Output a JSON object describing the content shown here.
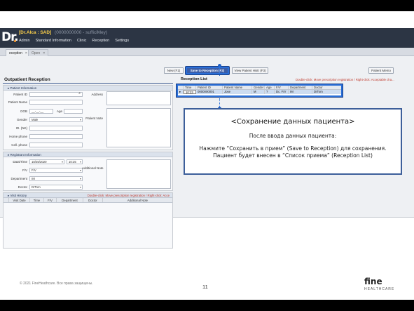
{
  "app": {
    "logo": "Dr.",
    "system_name": "[Dr.Alca : SAD]",
    "system_sub": "(0000000000 - sufficiMey)",
    "menu": [
      "Admin",
      "Standard Information",
      "Clinic",
      "Reception",
      "Settings"
    ],
    "tabs": [
      {
        "label": "eception",
        "close": "×"
      },
      {
        "label": "Open",
        "close": "×"
      }
    ]
  },
  "toolbar": {
    "new_label": "New (F1)",
    "save_label": "Save to Reception (F2)",
    "view_history_label": "View Patient Histr (F3)",
    "patient_memo_label": "Patient Memo"
  },
  "left": {
    "section_title": "Outpatient Reception",
    "patient_info": {
      "title": "Patient Information",
      "patient_id_label": "Patient ID",
      "patient_name_label": "Patient Name",
      "dob_label": "DOB",
      "dob_value": "__-__-__",
      "age_label": "Age",
      "gender_label": "Gender",
      "gender_value": "Male",
      "id_no_label": "ID. (NK)",
      "home_phone_label": "Home phone",
      "cell_phone_label": "Cell. phone",
      "address_label": "Address",
      "patient_note_label": "Patient Note"
    },
    "registrant_info": {
      "title": "Registrant Information",
      "datetime_label": "Data/Time",
      "date_value": "10/25/2020",
      "time_value": "10:25",
      "fv_label": "F/V",
      "fv_value": "F/V",
      "department_label": "Department",
      "department_value": "IM",
      "doctor_label": "Doctor",
      "doctor_value": "DrTom",
      "additional_note_label": "Additional Note"
    },
    "visit_history": {
      "title": "Visit History",
      "hint": "Double-click: Move prescription registration / Right-click: Acce",
      "columns": [
        "",
        "Visit Date",
        "Time",
        "F/V",
        "Department",
        "Doctor",
        "Additional Note"
      ]
    }
  },
  "right": {
    "title": "Reception List",
    "hint": "Double-click: Move prescription registration / Right-click: Acceptable cha...",
    "columns": [
      "",
      "Time",
      "Patient ID",
      "Patient Name",
      "Gender",
      "Age",
      "F/V",
      "Department",
      "Doctor"
    ],
    "rows": [
      [
        "▸",
        "10:23",
        "0000000001",
        "Jose",
        "M",
        "?",
        "Dc. F/V",
        "IM",
        "DrTom"
      ]
    ]
  },
  "callout": {
    "title": "<Сохранение данных пациента>",
    "subtitle": "После ввода данных пациента:",
    "line1": "Нажмите “Сохранить в прием” (Save to Reception) для сохранения.",
    "line2": "Пациент будет внесен в “Список приема” (Reception List)"
  },
  "footer": {
    "copyright": "© 2021 FineHeathcare. Все права защищены.",
    "page_number": "11",
    "brand": "fine",
    "brand_sub": "HEALTHCARE"
  },
  "colors": {
    "topbar": "#2c3544",
    "highlight": "#2a6fd8",
    "callout_border": "#3d5f9a",
    "hint_red": "#c0392b"
  }
}
